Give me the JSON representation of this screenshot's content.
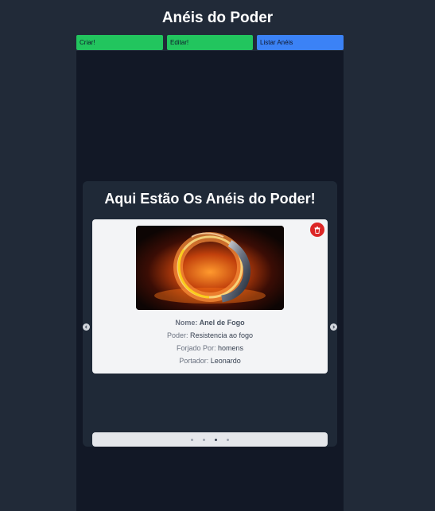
{
  "page": {
    "title": "Anéis do Poder"
  },
  "nav": {
    "create_label": "Criar!",
    "edit_label": "Editar!",
    "list_label": "Listar Anéis"
  },
  "panel": {
    "title": "Aqui Estão Os Anéis do Poder!"
  },
  "ring": {
    "name_label": "Nome:",
    "name": "Anel de Fogo",
    "power_label": "Poder:",
    "power": "Resistencia ao fogo",
    "forged_label": "Forjado Por:",
    "forged_by": "homens",
    "bearer_label": "Portador:",
    "bearer": "Leonardo"
  },
  "carousel": {
    "dot_count": 4,
    "active_index": 2
  },
  "icons": {
    "delete": "trash-icon",
    "prev": "chevron-left-icon",
    "next": "chevron-right-icon"
  },
  "colors": {
    "create_button": "#22c55e",
    "edit_button": "#22c55e",
    "list_button": "#3b82f6",
    "delete_button": "#dc2626"
  }
}
